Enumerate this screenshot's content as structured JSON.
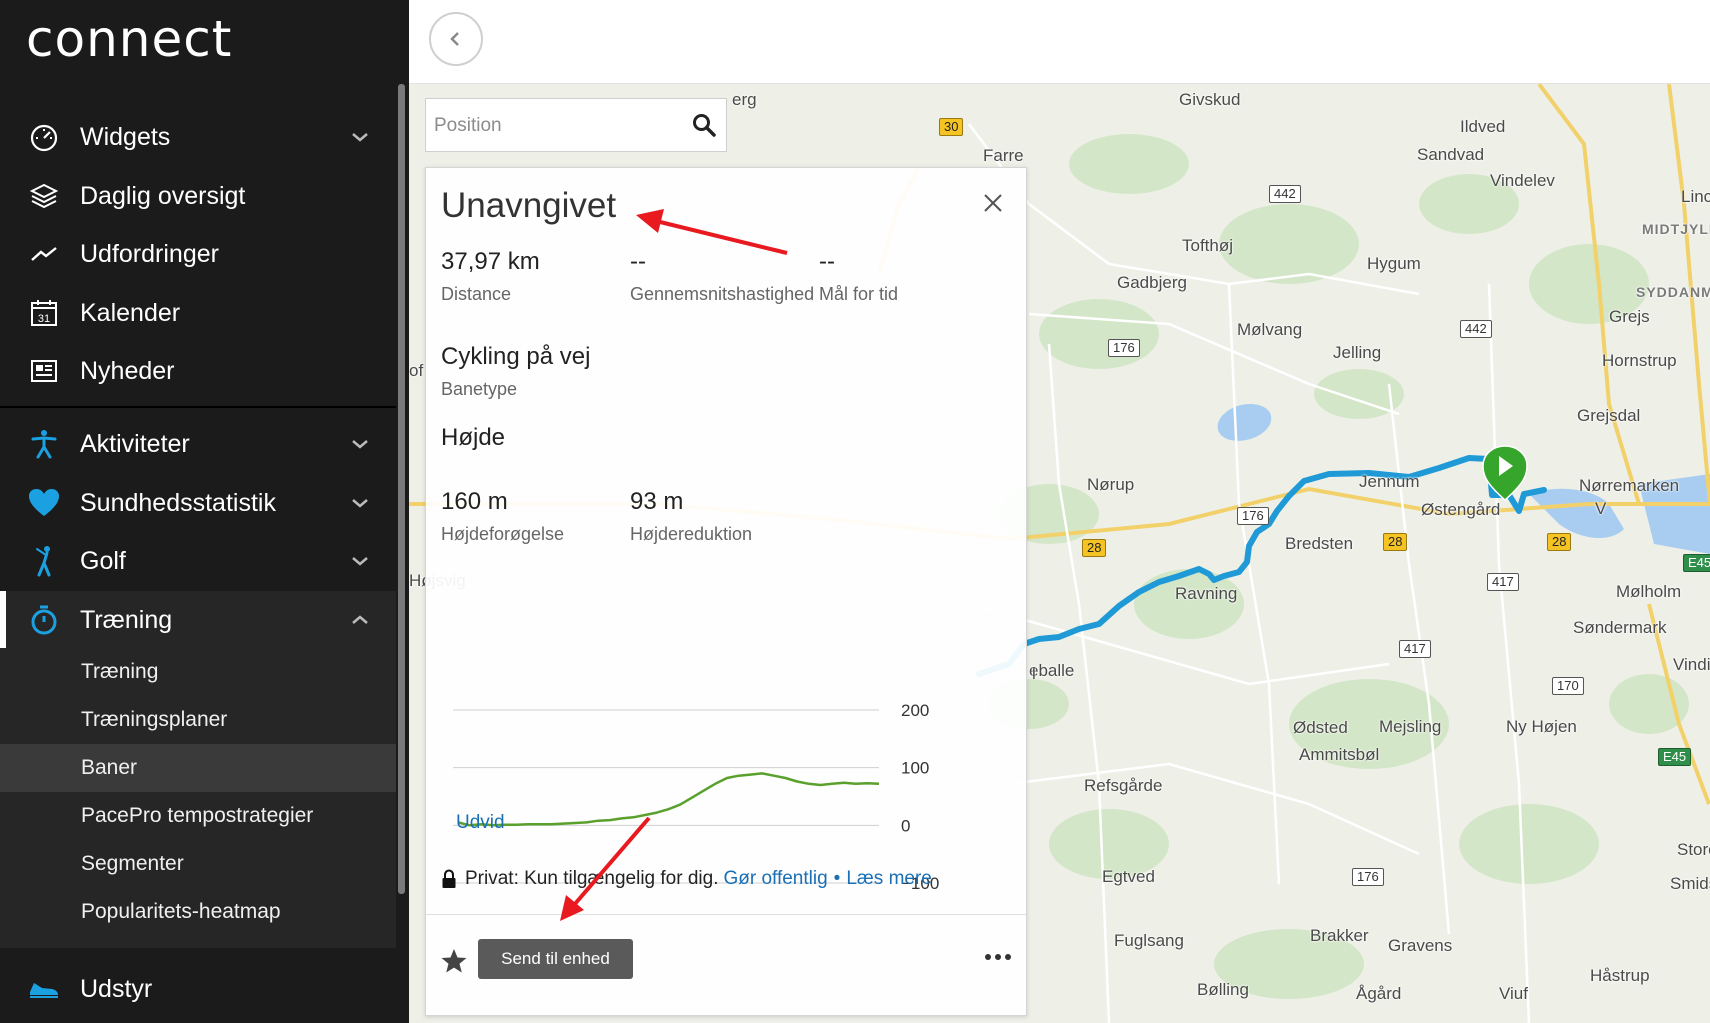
{
  "app": {
    "logo_text": "connect"
  },
  "sidebar": {
    "items": [
      {
        "label": "Widgets",
        "icon": "speedometer-icon"
      },
      {
        "label": "Daglig oversigt",
        "icon": "layers-icon"
      },
      {
        "label": "Udfordringer",
        "icon": "trend-icon"
      },
      {
        "label": "Kalender",
        "icon": "calendar-icon",
        "icon_text": "31"
      },
      {
        "label": "Nyheder",
        "icon": "newspaper-icon"
      },
      {
        "label": "Aktiviteter",
        "icon": "runner-icon"
      },
      {
        "label": "Sundhedsstatistik",
        "icon": "heart-icon"
      },
      {
        "label": "Golf",
        "icon": "golfer-icon"
      },
      {
        "label": "Træning",
        "icon": "stopwatch-icon"
      },
      {
        "label": "Udstyr",
        "icon": "shoe-icon"
      }
    ],
    "sub_items": [
      {
        "label": "Træning"
      },
      {
        "label": "Træningsplaner"
      },
      {
        "label": "Baner"
      },
      {
        "label": "PacePro tempostrategier"
      },
      {
        "label": "Segmenter"
      },
      {
        "label": "Popularitets-heatmap"
      }
    ],
    "selected_sub": "Baner",
    "accent_color": "#1ba0e1"
  },
  "search": {
    "placeholder": "Position"
  },
  "course": {
    "title": "Unavngivet",
    "distance_value": "37,97 km",
    "distance_label": "Distance",
    "avg_speed_value": "--",
    "avg_speed_label": "Gennemsnitshastighed",
    "goal_time_value": "--",
    "goal_time_label": "Mål for tid",
    "course_type_value": "Cykling på vej",
    "course_type_label": "Banetype",
    "elevation_heading": "Højde",
    "gain_value": "160 m",
    "gain_label": "Højdeforøgelse",
    "loss_value": "93 m",
    "loss_label": "Højdereduktion",
    "expand_label": "Udvid",
    "privacy_text": "Privat: Kun tilgængelig for dig.",
    "make_public_label": "Gør offentlig",
    "privacy_separator": "•",
    "read_more_label": "Læs mere",
    "send_button_label": "Send til enhed"
  },
  "chart_data": {
    "type": "line",
    "series": [
      {
        "values": [
          5,
          0,
          2,
          0,
          1,
          1,
          2,
          2,
          2,
          3,
          4,
          5,
          8,
          9,
          12,
          14,
          18,
          22,
          28,
          36,
          48,
          60,
          72,
          82,
          86,
          88,
          90,
          86,
          82,
          76,
          72,
          70,
          72,
          74,
          72,
          73,
          72
        ]
      }
    ],
    "y_ticks": [
      "200",
      "100",
      "0",
      "−100"
    ],
    "ylim": [
      -100,
      200
    ],
    "color": "#5aa02c",
    "grid": true
  },
  "map": {
    "places": [
      {
        "name": "Givskud"
      },
      {
        "name": "Ildved"
      },
      {
        "name": "Sandvad"
      },
      {
        "name": "Vindelev"
      },
      {
        "name": "Farre"
      },
      {
        "name": "Tofthøj"
      },
      {
        "name": "Hygum"
      },
      {
        "name": "Gadbjerg"
      },
      {
        "name": "Mølvang"
      },
      {
        "name": "Jelling"
      },
      {
        "name": "Grejs"
      },
      {
        "name": "Hornstrup"
      },
      {
        "name": "Grejsdal"
      },
      {
        "name": "Nørup"
      },
      {
        "name": "Jennum"
      },
      {
        "name": "Nørremarken"
      },
      {
        "name": "Østengård"
      },
      {
        "name": "Bredsten"
      },
      {
        "name": "Ravning"
      },
      {
        "name": "Mølholm"
      },
      {
        "name": "Søndermark"
      },
      {
        "name": "Vindi"
      },
      {
        "name": "eballe"
      },
      {
        "name": "Ødsted"
      },
      {
        "name": "Mejsling"
      },
      {
        "name": "Ny Højen"
      },
      {
        "name": "Ammitsbøl"
      },
      {
        "name": "Refsgårde"
      },
      {
        "name": "Egtved"
      },
      {
        "name": "Store"
      },
      {
        "name": "Smidstrup"
      },
      {
        "name": "Fuglsang"
      },
      {
        "name": "Brakker"
      },
      {
        "name": "Gravens"
      },
      {
        "name": "Håstrup"
      },
      {
        "name": "Bølling"
      },
      {
        "name": "Ågård"
      },
      {
        "name": "Viuf"
      },
      {
        "name": "Linc"
      },
      {
        "name": "V"
      },
      {
        "name": "erg"
      },
      {
        "name": "of"
      },
      {
        "name": "l"
      },
      {
        "name": "Højsvig"
      }
    ],
    "regions": [
      {
        "name": "MIDTJYLL"
      },
      {
        "name": "SYDDANM"
      }
    ],
    "roads": [
      {
        "label": "30"
      },
      {
        "label": "442"
      },
      {
        "label": "442"
      },
      {
        "label": "176"
      },
      {
        "label": "176"
      },
      {
        "label": "28"
      },
      {
        "label": "28"
      },
      {
        "label": "28"
      },
      {
        "label": "417"
      },
      {
        "label": "417"
      },
      {
        "label": "170"
      },
      {
        "label": "176"
      },
      {
        "label": "E45"
      },
      {
        "label": "E45"
      }
    ],
    "route_color": "#1f9ad6",
    "start_marker_color": "#35a52c"
  }
}
